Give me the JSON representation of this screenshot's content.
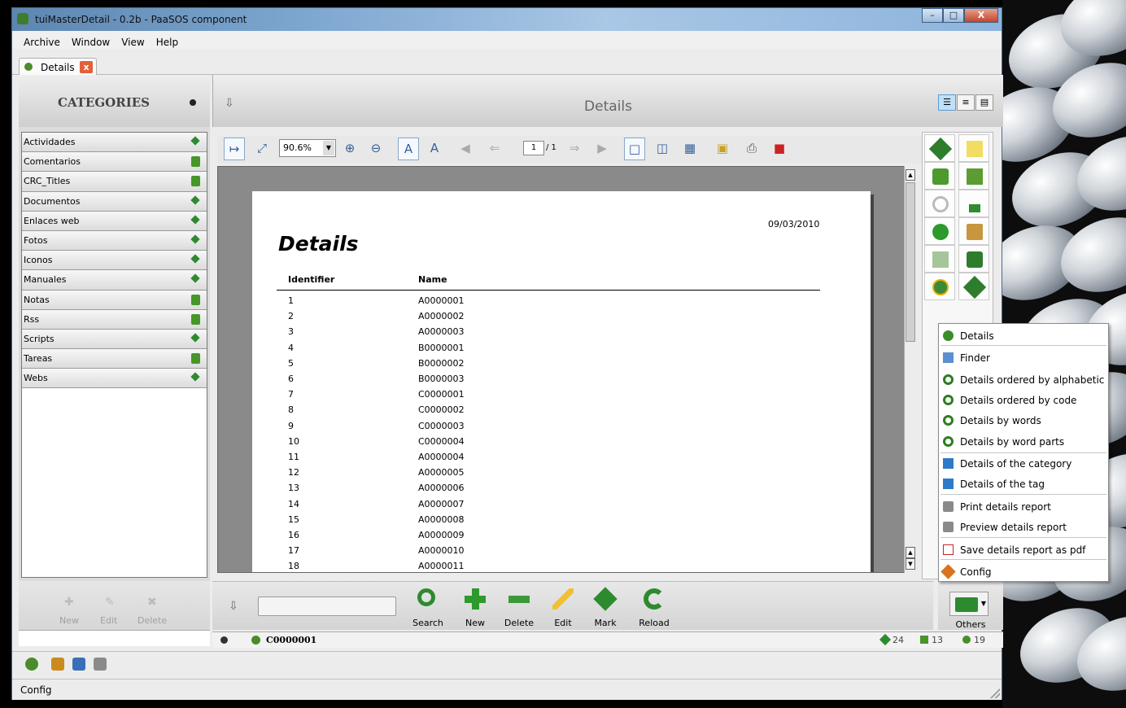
{
  "window": {
    "title": "tuiMasterDetail - 0.2b - PaaSOS component",
    "minimize": "–",
    "maximize": "□",
    "close": "X"
  },
  "menu": [
    "Archive",
    "Window",
    "View",
    "Help"
  ],
  "tab": {
    "label": "Details",
    "close": "x"
  },
  "sidebar": {
    "title": "CATEGORIES",
    "items": [
      {
        "label": "Actividades",
        "icon": "diamond-icon"
      },
      {
        "label": "Comentarios",
        "icon": "book-icon"
      },
      {
        "label": "CRC_Titles",
        "icon": "book-icon"
      },
      {
        "label": "Documentos",
        "icon": "diamond-icon"
      },
      {
        "label": "Enlaces web",
        "icon": "diamond-icon"
      },
      {
        "label": "Fotos",
        "icon": "diamond-icon"
      },
      {
        "label": "Iconos",
        "icon": "diamond-icon"
      },
      {
        "label": "Manuales",
        "icon": "diamond-icon"
      },
      {
        "label": "Notas",
        "icon": "book-icon"
      },
      {
        "label": "Rss",
        "icon": "book-icon"
      },
      {
        "label": "Scripts",
        "icon": "diamond-icon"
      },
      {
        "label": "Tareas",
        "icon": "book-icon"
      },
      {
        "label": "Webs",
        "icon": "diamond-icon"
      }
    ],
    "actions": {
      "new": "New",
      "edit": "Edit",
      "delete": "Delete"
    }
  },
  "main": {
    "title": "Details",
    "zoom": "90.6%",
    "page_current": "1",
    "page_total": "/ 1",
    "report": {
      "date": "09/03/2010",
      "title": "Details",
      "col_identifier": "Identifier",
      "col_name": "Name",
      "rows": [
        [
          "1",
          "A0000001"
        ],
        [
          "2",
          "A0000002"
        ],
        [
          "3",
          "A0000003"
        ],
        [
          "4",
          "B0000001"
        ],
        [
          "5",
          "B0000002"
        ],
        [
          "6",
          "B0000003"
        ],
        [
          "7",
          "C0000001"
        ],
        [
          "8",
          "C0000002"
        ],
        [
          "9",
          "C0000003"
        ],
        [
          "10",
          "C0000004"
        ],
        [
          "11",
          "A0000004"
        ],
        [
          "12",
          "A0000005"
        ],
        [
          "13",
          "A0000006"
        ],
        [
          "14",
          "A0000007"
        ],
        [
          "15",
          "A0000008"
        ],
        [
          "16",
          "A0000009"
        ],
        [
          "17",
          "A0000010"
        ],
        [
          "18",
          "A0000011"
        ]
      ]
    }
  },
  "bottom_actions": {
    "search": "Search",
    "new": "New",
    "delete": "Delete",
    "edit": "Edit",
    "mark": "Mark",
    "reload": "Reload",
    "others": "Others"
  },
  "status": {
    "code": "C0000001",
    "count_marked": "24",
    "count_books": "13",
    "count_details": "19"
  },
  "context_menu": [
    {
      "label": "Details",
      "icon": "details-icon"
    },
    {
      "label": "Finder",
      "icon": "finder-icon"
    },
    {
      "label": "Details ordered by alphabetic",
      "icon": "search-icon"
    },
    {
      "label": "Details ordered by code",
      "icon": "search-icon"
    },
    {
      "label": "Details by words",
      "icon": "search-icon"
    },
    {
      "label": "Details by word parts",
      "icon": "search-icon"
    },
    {
      "label": "Details of the category",
      "icon": "tree-icon"
    },
    {
      "label": "Details of the tag",
      "icon": "tree-icon"
    },
    {
      "label": "Print details report",
      "icon": "printer-icon"
    },
    {
      "label": "Preview details report",
      "icon": "printer-icon"
    },
    {
      "label": "Save details report as pdf",
      "icon": "pdf-icon"
    },
    {
      "label": "Config",
      "icon": "config-icon"
    }
  ],
  "statusbar": {
    "text": "Config"
  }
}
